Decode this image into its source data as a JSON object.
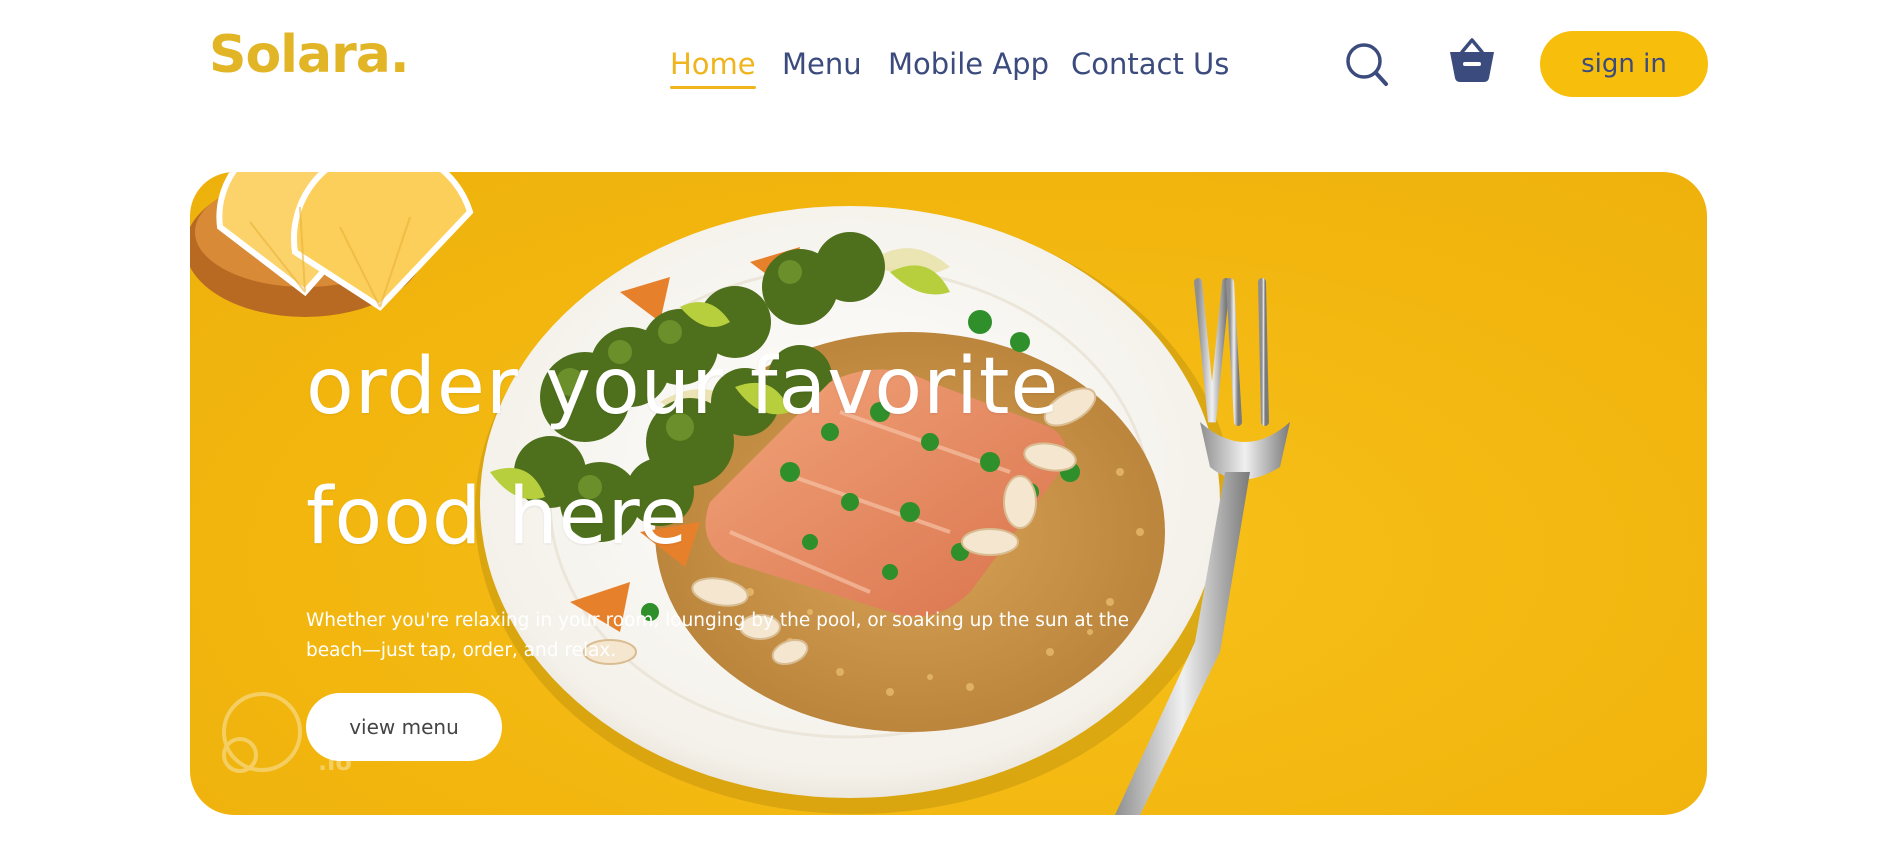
{
  "brand": {
    "logo": "Solara."
  },
  "nav": {
    "items": [
      {
        "label": "Home",
        "active": true
      },
      {
        "label": "Menu",
        "active": false
      },
      {
        "label": "Mobile App",
        "active": false
      },
      {
        "label": "Contact Us",
        "active": false
      }
    ]
  },
  "header": {
    "search_icon": "search-icon",
    "cart_icon": "basket-icon",
    "signin_label": "sign in"
  },
  "hero": {
    "title_line1": "order your favorite",
    "title_line2": "food here",
    "description": "Whether you're relaxing in your room, lounging by the pool, or soaking up the sun at the beach—just tap, order, and relax.",
    "cta_label": "view menu",
    "watermark_text": ".io"
  },
  "colors": {
    "brand_yellow": "#f7be0c",
    "logo_gold": "#e2b526",
    "nav_text": "#3b4b7d",
    "nav_active": "#f0b41d",
    "hero_bg": "#f2b60f"
  }
}
